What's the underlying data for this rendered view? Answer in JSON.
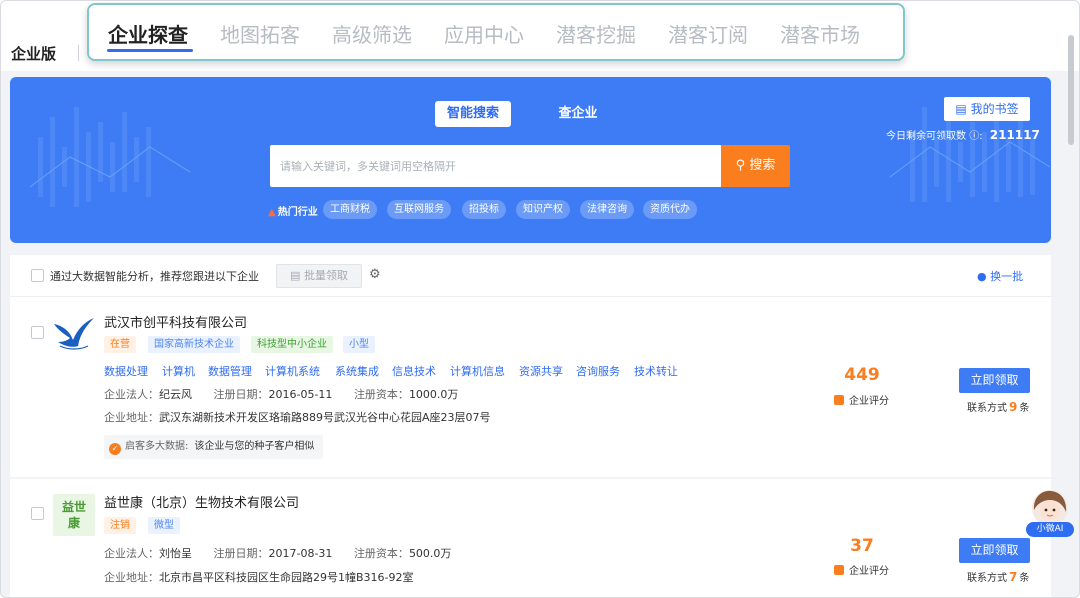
{
  "header": {
    "edition": "企业版",
    "nav_tabs": [
      {
        "label": "企业探查",
        "active": true
      },
      {
        "label": "地图拓客"
      },
      {
        "label": "高级筛选"
      },
      {
        "label": "应用中心"
      },
      {
        "label": "潜客挖掘"
      },
      {
        "label": "潜客订阅"
      },
      {
        "label": "潜客市场"
      }
    ]
  },
  "hero": {
    "search_tabs": [
      "智能搜索",
      "查企业"
    ],
    "bookmark_label": "我的书签",
    "remaining_label": "今日剩余可领取数",
    "remaining_value": "211117",
    "search_placeholder": "请输入关键词，多关键词用空格隔开",
    "search_button": "搜索",
    "hot_label": "热门行业",
    "hot_tags": [
      "工商财税",
      "互联网服务",
      "招投标",
      "知识产权",
      "法律咨询",
      "资质代办"
    ]
  },
  "recommend": {
    "text": "通过大数据智能分析，推荐您跟进以下企业",
    "batch_button": "批量领取",
    "refresh_label": "换一批"
  },
  "companies": [
    {
      "name": "武汉市创平科技有限公司",
      "tags": [
        "在营",
        "国家高新技术企业",
        "科技型中小企业",
        "小型"
      ],
      "keywords": [
        "数据处理",
        "计算机",
        "数据管理",
        "计算机系统",
        "系统集成",
        "信息技术",
        "计算机信息",
        "资源共享",
        "咨询服务",
        "技术转让"
      ],
      "legal_label": "企业法人：",
      "legal_value": "纪云风",
      "date_label": "注册日期：",
      "date_value": "2016-05-11",
      "capital_label": "注册资本：",
      "capital_value": "1000.0万",
      "address_label": "企业地址：",
      "address_value": "武汉东湖新技术开发区珞瑜路889号武汉光谷中心花园A座23层07号",
      "hint_label": "启客多大数据:",
      "hint_text": "该企业与您的种子客户相似",
      "score": "449",
      "score_label": "企业评分",
      "claim_button": "立即领取",
      "contact_prefix": "联系方式",
      "contact_count": "9",
      "contact_suffix": "条"
    },
    {
      "name": "益世康（北京）生物技术有限公司",
      "logo_text": "益世康",
      "tags": [
        "注销",
        "微型"
      ],
      "legal_label": "企业法人：",
      "legal_value": "刘怡呈",
      "date_label": "注册日期：",
      "date_value": "2017-08-31",
      "capital_label": "注册资本：",
      "capital_value": "500.0万",
      "address_label": "企业地址：",
      "address_value": "北京市昌平区科技园区生命园路29号1幢B316-92室",
      "score": "37",
      "score_label": "企业评分",
      "claim_button": "立即领取",
      "contact_prefix": "联系方式",
      "contact_count": "7",
      "contact_suffix": "条"
    }
  ],
  "assistant": {
    "label": "小微AI"
  },
  "colors": {
    "primary": "#3d7cf5",
    "accent": "#fa7d1e",
    "highlight_border": "#7fc6cf"
  }
}
